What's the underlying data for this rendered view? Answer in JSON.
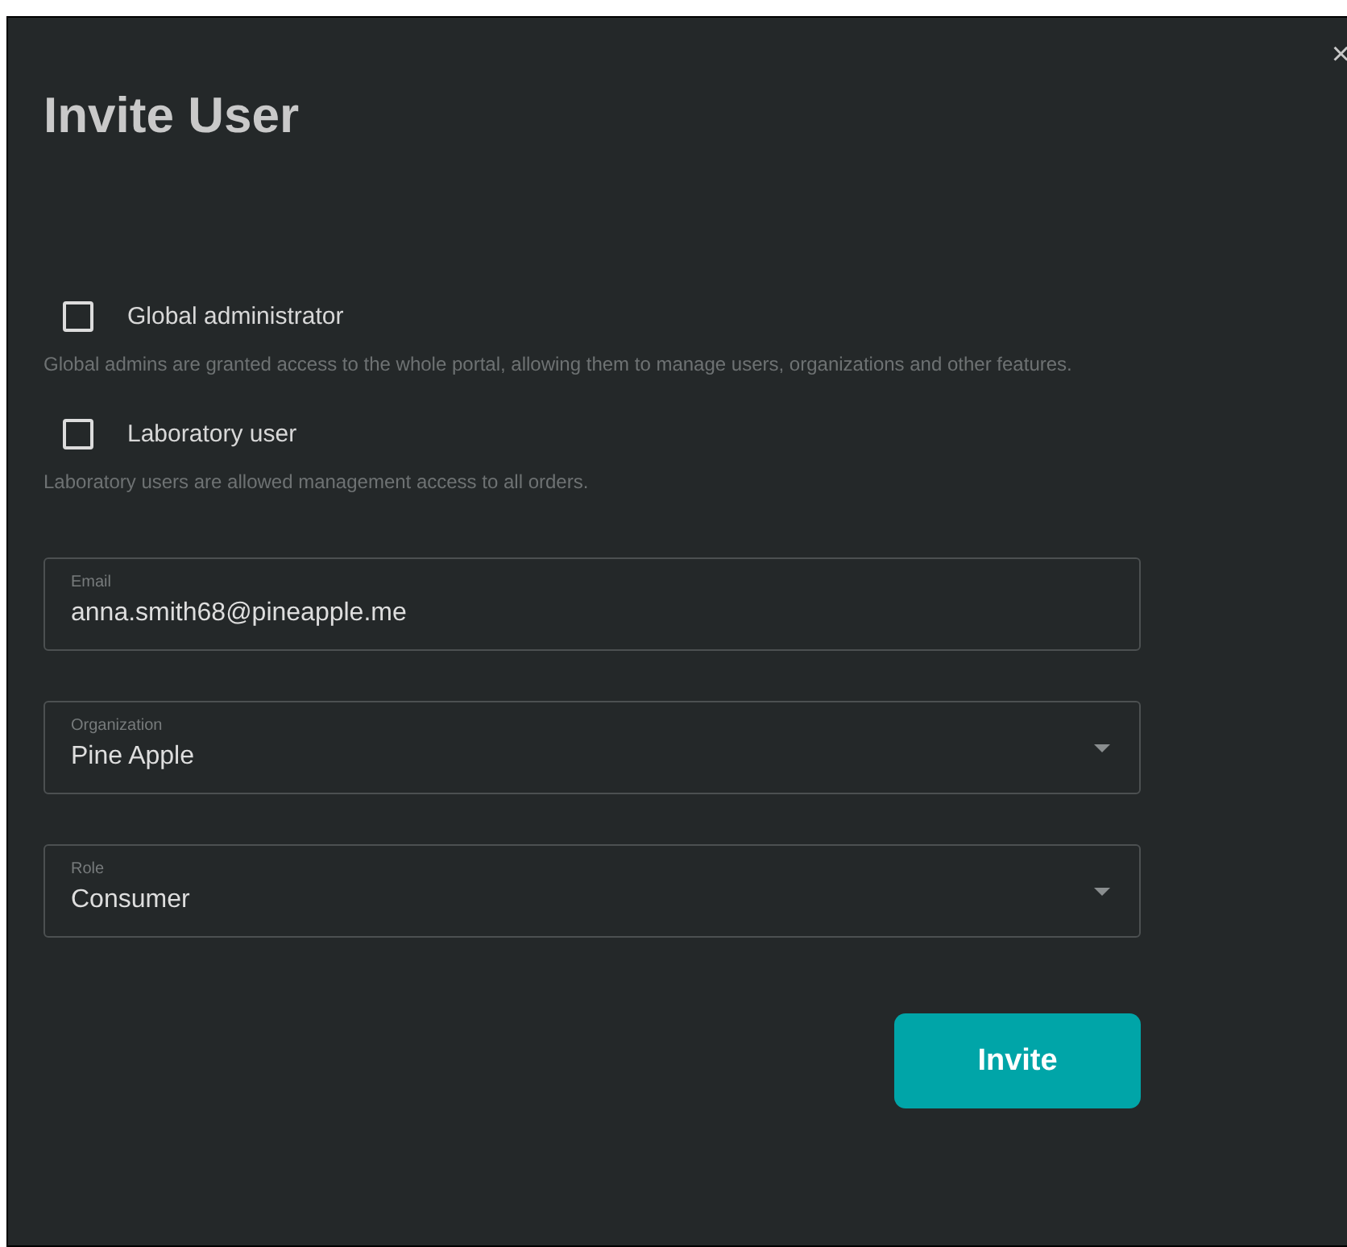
{
  "dialog": {
    "title": "Invite User",
    "close": "×"
  },
  "options": [
    {
      "label": "Global administrator",
      "checked": false,
      "description": "Global admins are granted access to the whole portal, allowing them to manage users, organizations and other features."
    },
    {
      "label": "Laboratory user",
      "checked": false,
      "description": "Laboratory users are allowed management access to all orders."
    }
  ],
  "fields": [
    {
      "kind": "text",
      "label": "Email",
      "value": "anna.smith68@pineapple.me"
    },
    {
      "kind": "select",
      "label": "Organization",
      "value": "Pine Apple"
    },
    {
      "kind": "select",
      "label": "Role",
      "value": "Consumer"
    }
  ],
  "buttons": [
    "Invite"
  ]
}
